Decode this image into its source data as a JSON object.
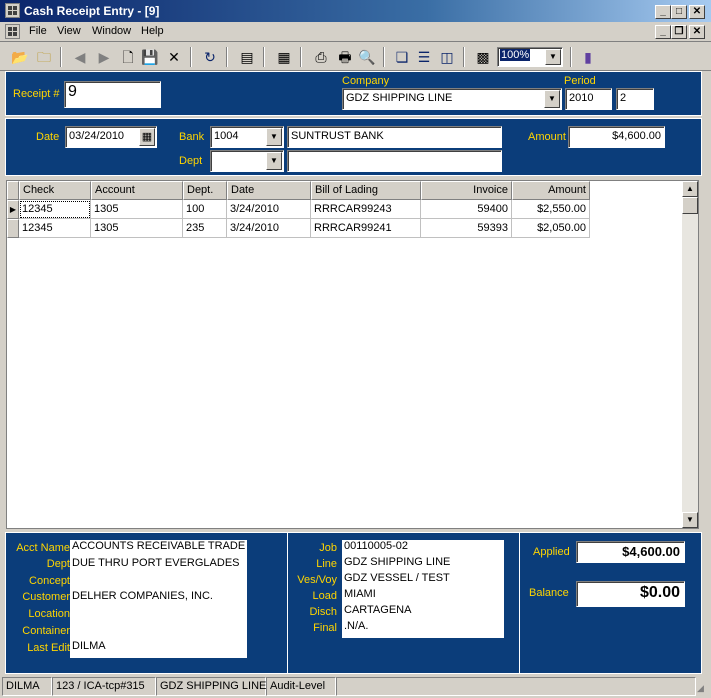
{
  "window": {
    "title": "Cash Receipt Entry - [9]"
  },
  "menu": {
    "items": [
      "File",
      "View",
      "Window",
      "Help"
    ]
  },
  "toolbar": {
    "zoom": "100%"
  },
  "header": {
    "receipt_label": "Receipt #",
    "receipt_value": "9",
    "company_label": "Company",
    "company_value": "GDZ SHIPPING LINE",
    "period_label": "Period",
    "period_year": "2010",
    "period_num": "2"
  },
  "entry": {
    "date_label": "Date",
    "date_value": "03/24/2010",
    "bank_label": "Bank",
    "bank_code": "1004",
    "bank_name": "SUNTRUST BANK",
    "amount_label": "Amount",
    "amount_value": "$4,600.00",
    "dept_label": "Dept",
    "dept_value": "",
    "dept_name": ""
  },
  "grid": {
    "columns": [
      "Check",
      "Account",
      "Dept.",
      "Date",
      "Bill of Lading",
      "Invoice",
      "Amount"
    ],
    "rows": [
      [
        "12345",
        "1305",
        "100",
        "3/24/2010",
        "RRRCAR99243",
        "59400",
        "$2,550.00"
      ],
      [
        "12345",
        "1305",
        "235",
        "3/24/2010",
        "RRRCAR99241",
        "59393",
        "$2,050.00"
      ]
    ]
  },
  "details": {
    "left_labels": [
      "Acct Name",
      "Dept",
      "Concept",
      "Customer",
      "Location",
      "Container",
      "Last Edit"
    ],
    "left_values": [
      "ACCOUNTS RECEIVABLE TRADE",
      "DUE THRU PORT EVERGLADES",
      "",
      "DELHER COMPANIES, INC.",
      "",
      "",
      "DILMA"
    ],
    "mid_labels": [
      "Job",
      "Line",
      "Ves/Voy",
      "Load",
      "Disch",
      "Final"
    ],
    "mid_values": [
      "00110005-02",
      "GDZ SHIPPING LINE",
      "GDZ VESSEL / TEST",
      "MIAMI",
      "CARTAGENA",
      ".N/A."
    ],
    "applied_label": "Applied",
    "applied_value": "$4,600.00",
    "balance_label": "Balance",
    "balance_value": "$0.00"
  },
  "status": {
    "items": [
      "DILMA",
      "123 / ICA-tcp#315",
      "GDZ SHIPPING LINE",
      "Audit-Level"
    ]
  }
}
